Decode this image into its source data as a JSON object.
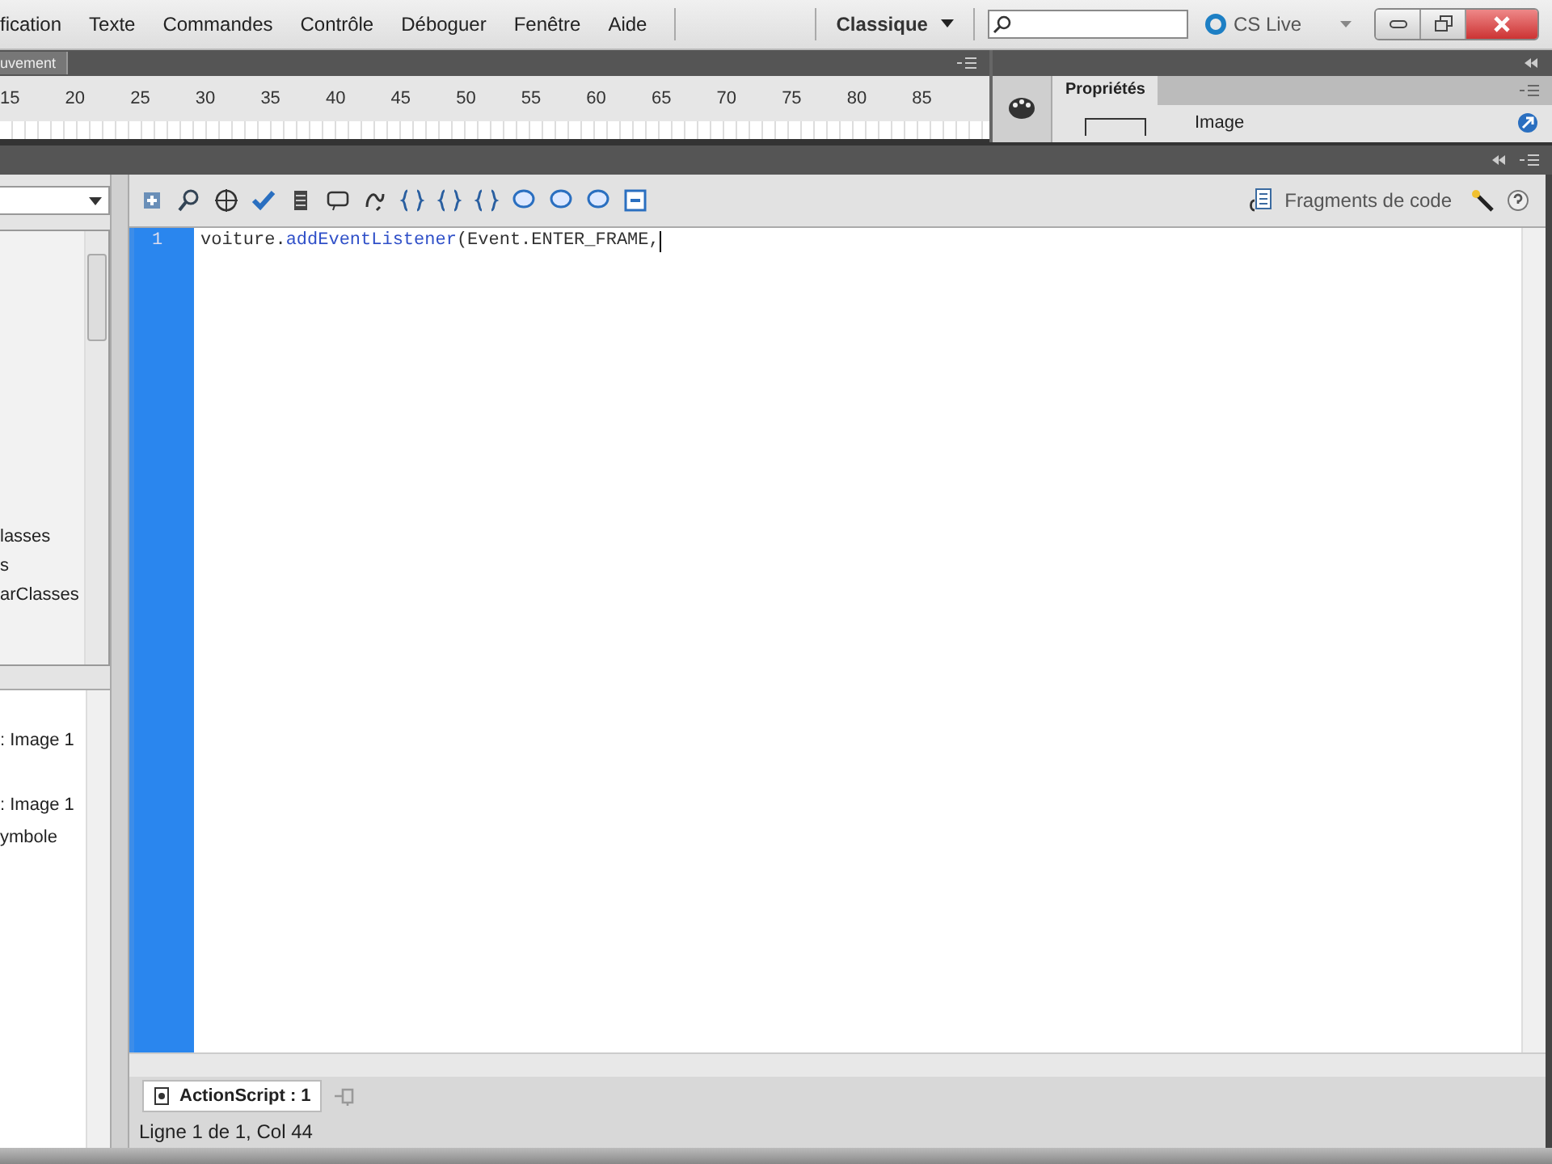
{
  "menu_bar": {
    "items": [
      "fication",
      "Texte",
      "Commandes",
      "Contrôle",
      "Déboguer",
      "Fenêtre",
      "Aide"
    ],
    "workspace": "Classique",
    "cs_live": "CS Live"
  },
  "timeline": {
    "tab": "uvement",
    "frame_numbers": [
      "15",
      "20",
      "25",
      "30",
      "35",
      "40",
      "45",
      "50",
      "55",
      "60",
      "65",
      "70",
      "75",
      "80",
      "85"
    ]
  },
  "properties": {
    "tab": "Propriétés",
    "label": "Image"
  },
  "actions_toolbar": {
    "snippets": "Fragments de code"
  },
  "left_tree": {
    "items": [
      "lasses",
      "s",
      "arClasses"
    ]
  },
  "left_list": {
    "items": [
      ": Image 1",
      ": Image 1",
      "ymbole"
    ]
  },
  "editor": {
    "line_numbers": [
      "1"
    ],
    "code": [
      {
        "kind": "plain",
        "text": "voiture."
      },
      {
        "kind": "method",
        "text": "addEventListener"
      },
      {
        "kind": "plain",
        "text": "(Event.ENTER_FRAME,"
      }
    ]
  },
  "script_tab": {
    "label": "ActionScript : 1"
  },
  "status_bar": "Ligne 1 de 1, Col 44"
}
